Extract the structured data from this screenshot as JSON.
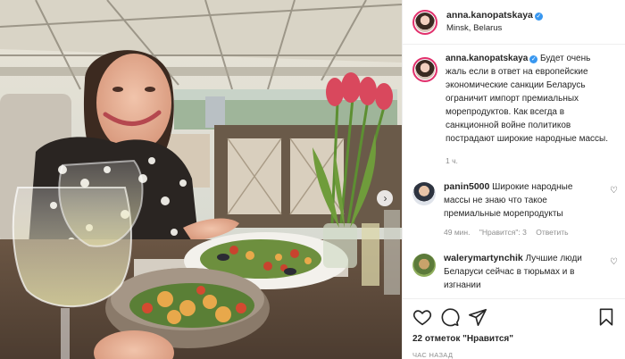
{
  "post": {
    "username": "anna.kanopatskaya",
    "location": "Minsk, Belarus",
    "caption": "Будет очень жаль если в ответ на европейские экономические санкции Беларусь ограничит импорт премиальных морепродуктов. Как всегда в санкционной войне политиков пострадают широкие народные массы.",
    "caption_time": "1 ч.",
    "likes": "22 отметок \"Нравится\"",
    "post_time": "ЧАС НАЗАД"
  },
  "comments": [
    {
      "username": "panin5000",
      "text": "Широкие народные массы не знаю что такое премиальные морепродукты",
      "time": "49 мин.",
      "likes": "\"Нравится\": 3",
      "reply": "Ответить"
    },
    {
      "username": "walerymartynchik",
      "text": "Лучшие люди Беларуси сейчас в тюрьмах и в изгнании"
    }
  ],
  "icons": {
    "like": "heart-icon",
    "comment": "comment-icon",
    "share": "share-icon",
    "save": "bookmark-icon",
    "next": "chevron-right-icon"
  },
  "colors": {
    "verified": "#3897f0",
    "story_ring": "#e1306c",
    "muted_text": "#8e8e8e"
  }
}
